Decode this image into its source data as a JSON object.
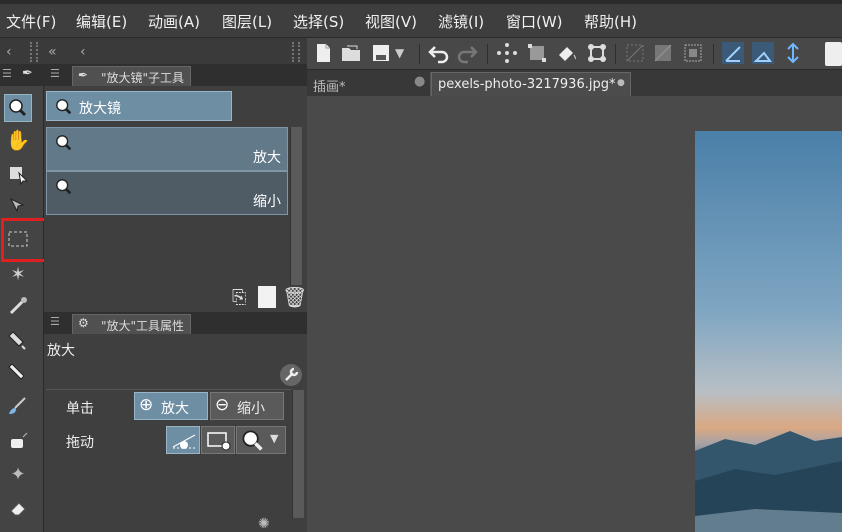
{
  "menu": [
    "文件(F)",
    "编辑(E)",
    "动画(A)",
    "图层(L)",
    "选择(S)",
    "视图(V)",
    "滤镜(I)",
    "窗口(W)",
    "帮助(H)"
  ],
  "subtool_panel": {
    "title": "\"放大镜\"子工具",
    "group": "放大镜",
    "items": [
      {
        "label": "放大",
        "selected": true
      },
      {
        "label": "缩小",
        "selected": false
      }
    ]
  },
  "property_panel": {
    "title": "\"放大\"工具属性",
    "tool_name": "放大",
    "click_label": "单击",
    "click_options": [
      "放大",
      "缩小"
    ],
    "drag_label": "拖动"
  },
  "documents": {
    "tabs": [
      {
        "label": "插画*",
        "active": false
      },
      {
        "label": "pexels-photo-3217936.jpg*",
        "active": true
      }
    ]
  },
  "colors": {
    "accent": "#6e8ea3",
    "annotation": "#e02020"
  }
}
